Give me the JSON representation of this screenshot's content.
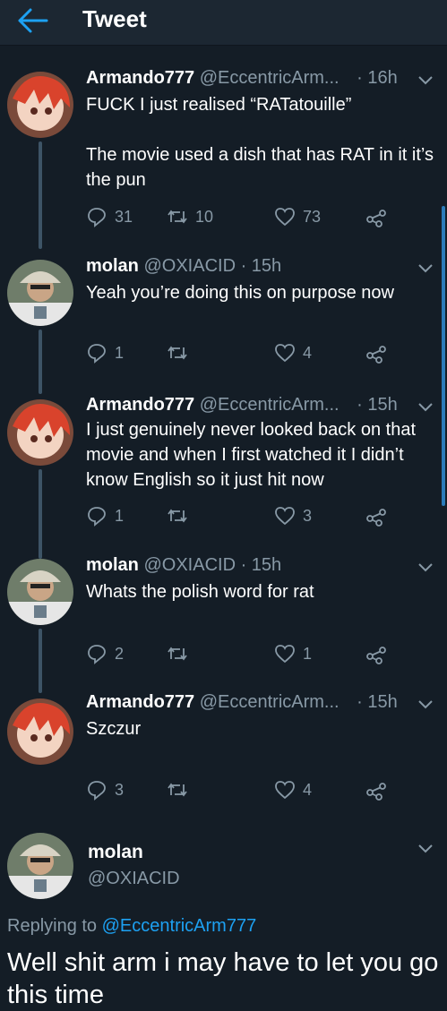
{
  "header": {
    "title": "Tweet"
  },
  "tweets": [
    {
      "name": "Armando777",
      "handle": "@EccentricArm...",
      "time": "· 16h",
      "text": "FUCK I just realised “RATatouille”\n\nThe movie used a dish that has RAT in it it’s the pun",
      "replies": "31",
      "retweets": "10",
      "likes": "73"
    },
    {
      "name": "molan",
      "handle": "@OXIACID",
      "time": "· 15h",
      "text": "Yeah you’re doing this on purpose now",
      "replies": "1",
      "retweets": "",
      "likes": "4"
    },
    {
      "name": "Armando777",
      "handle": "@EccentricArm...",
      "time": "· 15h",
      "text": "I just genuinely never looked back on that movie and when I first watched it I didn’t know English so it just hit now",
      "replies": "1",
      "retweets": "",
      "likes": "3"
    },
    {
      "name": "molan",
      "handle": "@OXIACID",
      "time": "· 15h",
      "text": "Whats the polish word for rat",
      "replies": "2",
      "retweets": "",
      "likes": "1"
    },
    {
      "name": "Armando777",
      "handle": "@EccentricArm...",
      "time": "· 15h",
      "text": "Szczur",
      "replies": "3",
      "retweets": "",
      "likes": "4"
    }
  ],
  "focused": {
    "name": "molan",
    "handle": "@OXIACID",
    "replying_prefix": "Replying to",
    "replying_to": "@EccentricArm777",
    "text": "Well shit arm i may have to let you go this time"
  },
  "colors": {
    "background": "#141d26",
    "secondary_text": "#8899a6",
    "accent": "#1da1f2"
  }
}
